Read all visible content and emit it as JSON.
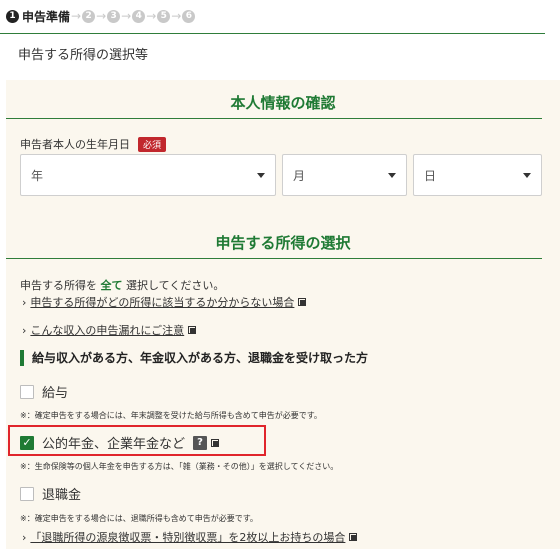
{
  "steps": {
    "current_number": "1",
    "current_label": "申告準備",
    "others": [
      "2",
      "3",
      "4",
      "5",
      "6"
    ]
  },
  "page_subtitle": "申告する所得の選択等",
  "personal_info": {
    "heading": "本人情報の確認",
    "dob_label": "申告者本人の生年月日",
    "required_badge": "必須",
    "year_placeholder": "年",
    "month_placeholder": "月",
    "day_placeholder": "日"
  },
  "income_selection": {
    "heading": "申告する所得の選択",
    "instruction_prefix": "申告する所得を",
    "instruction_emphasis": "全て",
    "instruction_suffix": "選択してください。",
    "link1": "申告する所得がどの所得に該当するか分からない場合",
    "link2": "こんな収入の申告漏れにご注意",
    "subheading": "給与収入がある方、年金収入がある方、退職金を受け取った方",
    "options": [
      {
        "label": "給与",
        "checked": false,
        "note": "※：確定申告をする場合には、年末調整を受けた給与所得も含めて申告が必要です。"
      },
      {
        "label": "公的年金、企業年金など",
        "checked": true,
        "help": "?",
        "note": "※：生命保険等の個人年金を申告する方は、「雑（業務・その他）」を選択してください。"
      },
      {
        "label": "退職金",
        "checked": false,
        "note": "※：確定申告をする場合には、退職所得も含めて申告が必要です。"
      }
    ],
    "link3": "「退職所得の源泉徴収票・特別徴収票」を2枚以上お持ちの場合"
  },
  "colors": {
    "accent_green": "#1f7a34",
    "required_red": "#c1272d",
    "highlight_red": "#e0252b",
    "panel_bg": "#fbf7ee"
  }
}
